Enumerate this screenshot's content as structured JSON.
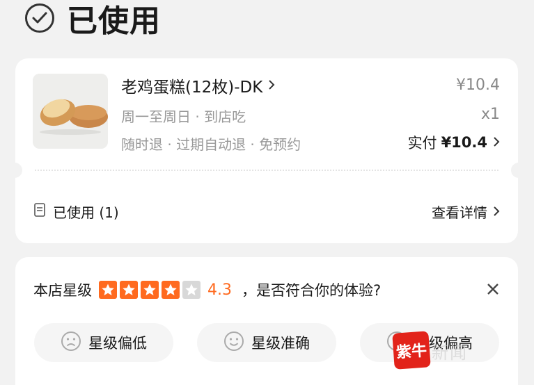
{
  "header": {
    "title": "已使用"
  },
  "order": {
    "product_name": "老鸡蛋糕(12枚)-DK",
    "schedule": "周一至周日 · 到店吃",
    "policy": "随时退 · 过期自动退 · 免预约",
    "price": "¥10.4",
    "quantity": "x1",
    "paid_label": "实付",
    "paid_amount": "¥10.4",
    "used_label": "已使用 (1)",
    "details_label": "查看详情"
  },
  "rating": {
    "prefix": "本店星级",
    "stars_filled": 4,
    "stars_total": 5,
    "score": "4.3",
    "question": "，是否符合你的体验?",
    "accent_color": "#ff6a1f",
    "options": [
      {
        "label": "星级偏低",
        "icon": "sad-face-icon"
      },
      {
        "label": "星级准确",
        "icon": "smile-face-icon"
      },
      {
        "label": "星级偏高",
        "icon": "face-icon"
      }
    ]
  },
  "watermark": {
    "logo_text": "紫牛",
    "text": "新闻"
  }
}
